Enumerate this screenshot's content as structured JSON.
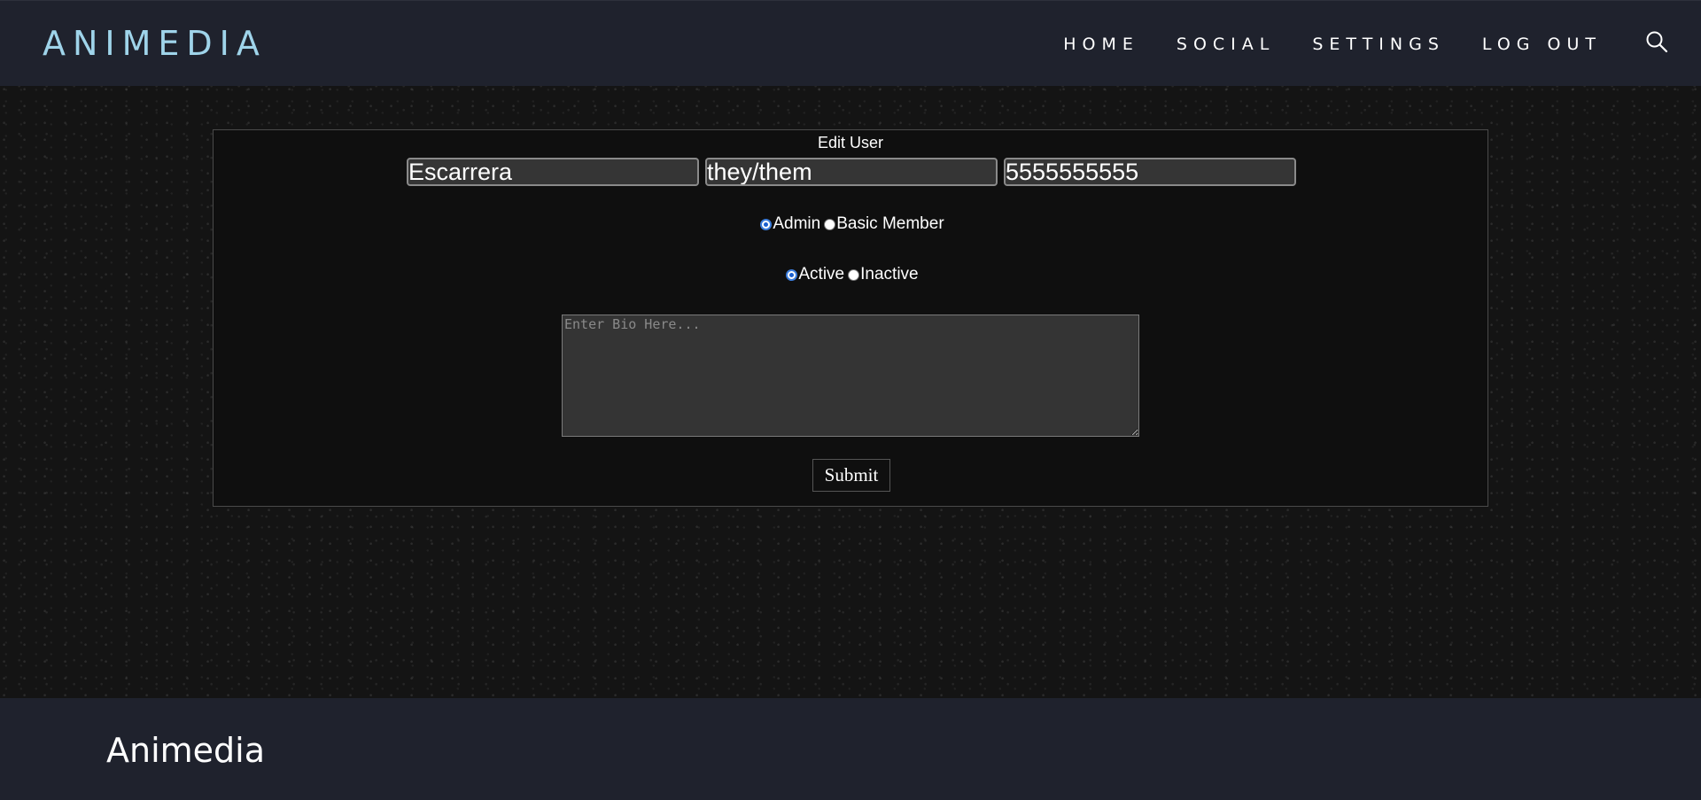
{
  "header": {
    "logo": "ANIMEDIA",
    "nav": [
      "HOME",
      "SOCIAL",
      "SETTINGS",
      "LOG OUT"
    ],
    "search_icon": "search-icon"
  },
  "form": {
    "title": "Edit User",
    "username": "Escarrera",
    "pronouns": "they/them",
    "phone": "5555555555",
    "role_options": [
      {
        "label": "Admin",
        "checked": true
      },
      {
        "label": "Basic Member",
        "checked": false
      }
    ],
    "status_options": [
      {
        "label": "Active",
        "checked": true
      },
      {
        "label": "Inactive",
        "checked": false
      }
    ],
    "bio_placeholder": "Enter Bio Here...",
    "submit_label": "Submit"
  },
  "footer": {
    "logo": "Animedia"
  },
  "colors": {
    "header_bg": "#1f222d",
    "logo_accent": "#9fd4ea",
    "panel_bg": "#0f0f0f",
    "input_bg": "#353535",
    "radio_accent": "#3b7ddd"
  }
}
